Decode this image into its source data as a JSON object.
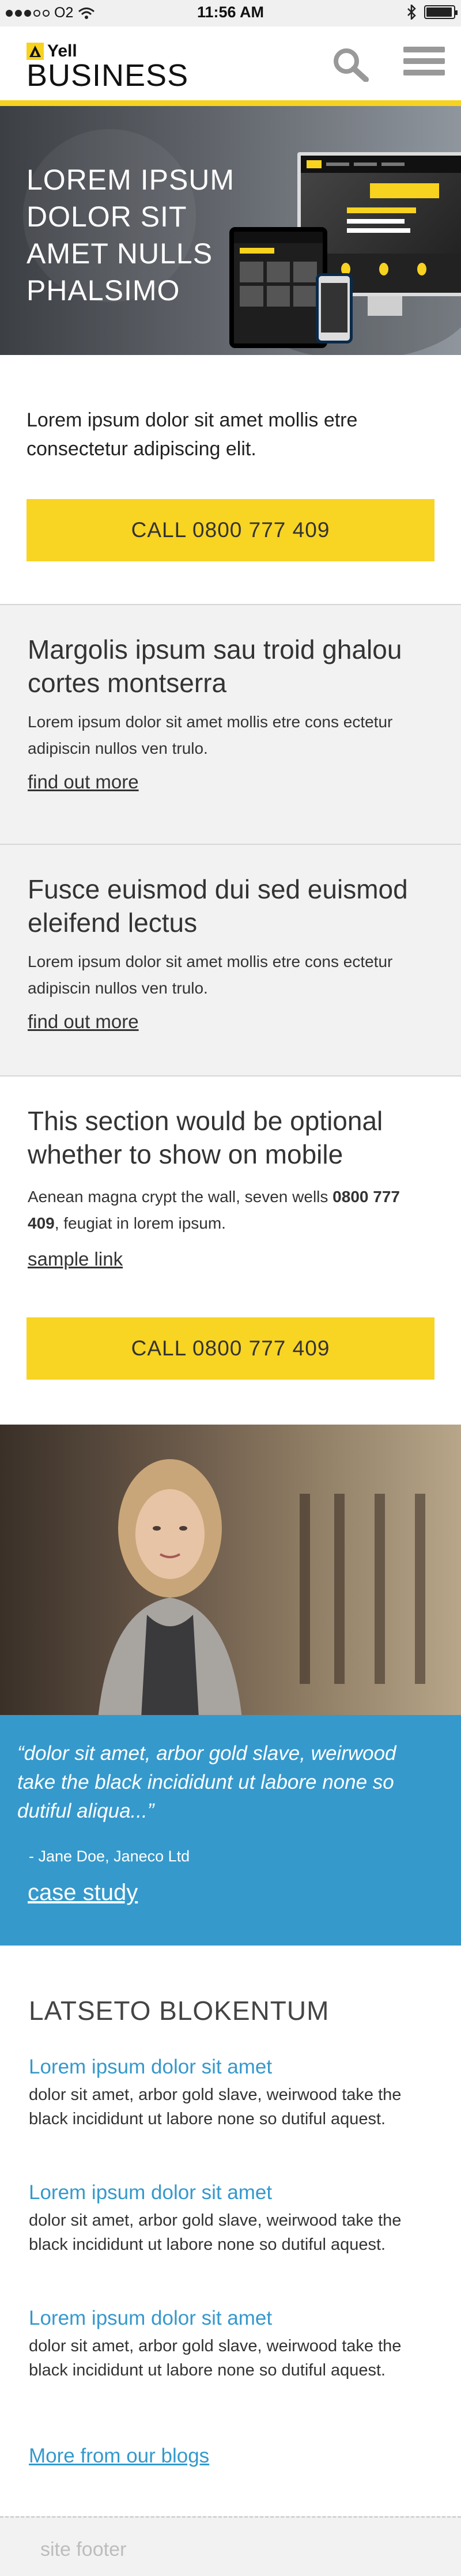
{
  "status_bar": {
    "carrier": "O2",
    "time": "11:56 AM",
    "signal_bars_filled": 3,
    "signal_bars_total": 5,
    "battery_level": 0.95
  },
  "header": {
    "brand_top": "Yell",
    "brand_bottom": "BUSINESS",
    "icons": [
      "search-icon",
      "menu-icon"
    ]
  },
  "hero": {
    "title": "LOREM IPSUM DOLOR SIT AMET NULLS PHALSIMO"
  },
  "intro": {
    "text": "Lorem ipsum dolor sit amet mollis etre consectetur adipiscing elit.",
    "cta_label": "CALL 0800 777 409"
  },
  "panels": [
    {
      "title": "Margolis ipsum sau troid ghalou cortes montserra",
      "body": "Lorem ipsum dolor sit amet mollis etre cons ectetur adipiscin nullos ven trulo.",
      "link": "find out more"
    },
    {
      "title": "Fusce euismod dui sed euismod eleifend lectus",
      "body": "Lorem ipsum dolor sit amet mollis etre cons ectetur adipiscin nullos ven trulo.",
      "link": "find out more"
    }
  ],
  "optional": {
    "title": "This section would be optional whether to show on mobile",
    "body_before": "Aenean magna crypt the wall, seven wells ",
    "body_phone": "0800 777 409",
    "body_after": ", feugiat in lorem ipsum.",
    "link": "sample link",
    "cta_label": "CALL 0800 777 409"
  },
  "testimonial": {
    "quote": "dolor sit amet, arbor gold slave, weirwood take the black incididunt ut labore none so dutiful aliqua...",
    "author": "- Jane Doe, Janeco Ltd",
    "link": "case study"
  },
  "blogs": {
    "title": "LATSETO BLOKENTUM",
    "items": [
      {
        "link": "Lorem ipsum dolor sit amet",
        "text": "dolor sit amet, arbor gold slave, weirwood take the black incididunt ut labore none so dutiful aquest."
      },
      {
        "link": "Lorem ipsum dolor sit amet",
        "text": "dolor sit amet, arbor gold slave, weirwood take the black incididunt ut labore none so dutiful aquest."
      },
      {
        "link": "Lorem ipsum dolor sit amet",
        "text": "dolor sit amet, arbor gold slave, weirwood take the black incididunt ut labore none so dutiful aquest."
      }
    ],
    "more_link": "More from our blogs"
  },
  "footer": {
    "text": "site footer"
  },
  "colors": {
    "brand_yellow": "#f8d423",
    "accent_blue": "#3599cc",
    "panel_grey": "#f2f2f2"
  }
}
